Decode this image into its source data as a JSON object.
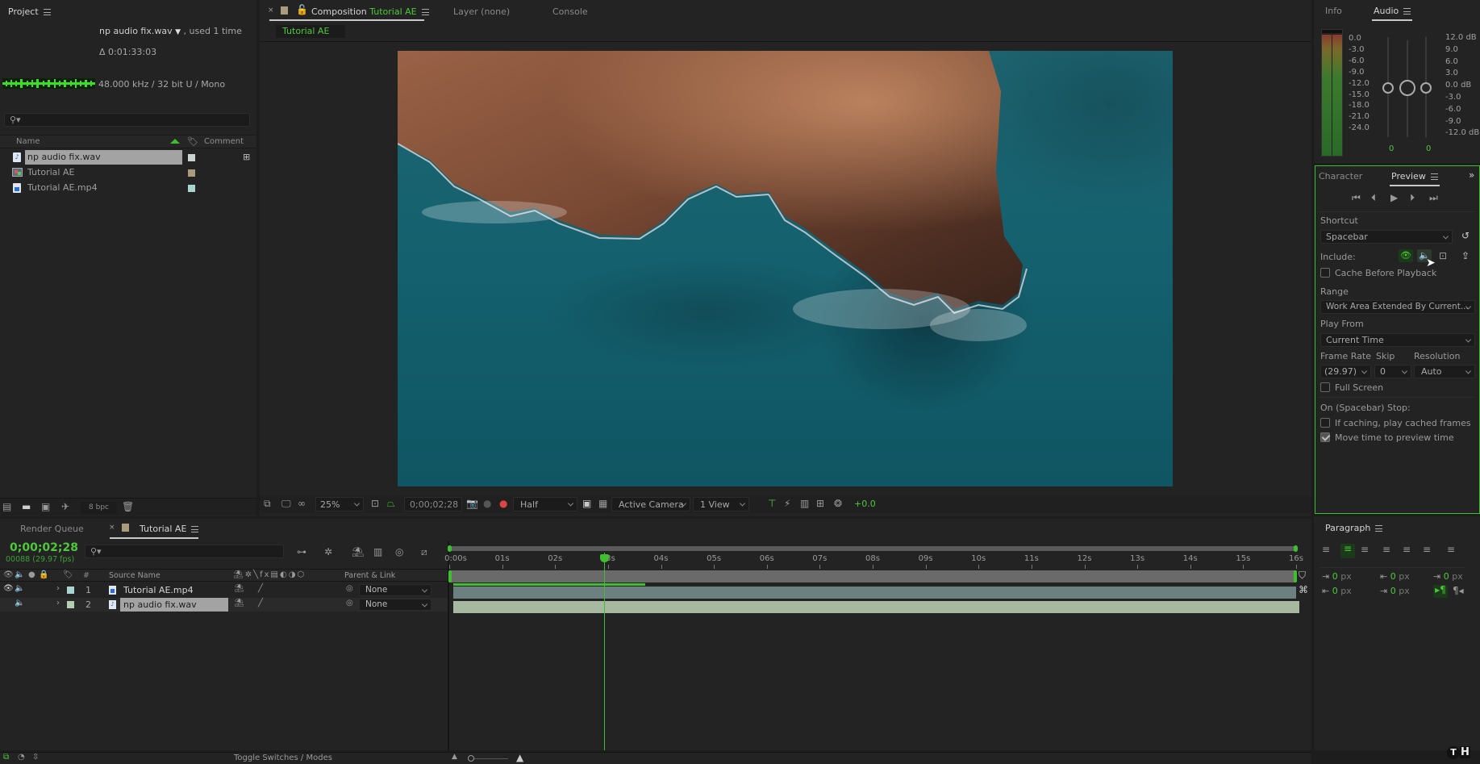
{
  "project_panel": {
    "title": "Project",
    "selected_item": {
      "name": "np audio fix.wav",
      "used": ", used 1 time",
      "duration": "Δ 0:01:33:03",
      "format": "48.000 kHz / 32 bit U / Mono"
    },
    "search_placeholder": "",
    "columns": {
      "name": "Name",
      "comment": "Comment"
    },
    "items": [
      {
        "name": "np audio fix.wav",
        "type": "audio",
        "label_color": "#c9d3d0",
        "selected": true
      },
      {
        "name": "Tutorial AE",
        "type": "composition",
        "label_color": "#a99b7c",
        "selected": false
      },
      {
        "name": "Tutorial AE.mp4",
        "type": "video",
        "label_color": "#a9d4d0",
        "selected": false
      }
    ],
    "bpc": "8 bpc"
  },
  "composition_panel": {
    "tabs": [
      {
        "label": "Composition",
        "comp_name": "Tutorial AE",
        "active": true
      },
      {
        "label": "Layer (none)",
        "active": false
      },
      {
        "label": "Console",
        "active": false
      }
    ],
    "breadcrumb": "Tutorial AE",
    "toolbar": {
      "zoom": "25%",
      "timecode": "0;00;02;28",
      "resolution": "Half",
      "camera": "Active Camera",
      "views": "1 View",
      "exposure": "+0.0"
    }
  },
  "audio_panel": {
    "tabs": [
      {
        "label": "Info",
        "active": false
      },
      {
        "label": "Audio",
        "active": true
      }
    ],
    "meter_scale": [
      "0.0",
      "-3.0",
      "-6.0",
      "-9.0",
      "-12.0",
      "-15.0",
      "-18.0",
      "-21.0",
      "-24.0"
    ],
    "db_scale": [
      "12.0 dB",
      "9.0",
      "6.0",
      "3.0",
      "0.0 dB",
      "-3.0",
      "-6.0",
      "-9.0",
      "-12.0 dB"
    ],
    "left_value": "0",
    "right_value": "0"
  },
  "preview_panel": {
    "tabs": [
      {
        "label": "Character",
        "active": false
      },
      {
        "label": "Preview",
        "active": true
      }
    ],
    "shortcut_label": "Shortcut",
    "shortcut_value": "Spacebar",
    "include_label": "Include:",
    "cache_before_playback": {
      "label": "Cache Before Playback",
      "checked": false
    },
    "range_label": "Range",
    "range_value": "Work Area Extended By Current...",
    "play_from_label": "Play From",
    "play_from_value": "Current Time",
    "frame_rate_label": "Frame Rate",
    "frame_rate_value": "(29.97)",
    "skip_label": "Skip",
    "skip_value": "0",
    "resolution_label": "Resolution",
    "resolution_value": "Auto",
    "full_screen": {
      "label": "Full Screen",
      "checked": false
    },
    "on_stop_label": "On (Spacebar) Stop:",
    "if_caching": {
      "label": "If caching, play cached frames",
      "checked": false
    },
    "move_time": {
      "label": "Move time to preview time",
      "checked": true
    }
  },
  "paragraph_panel": {
    "title": "Paragraph",
    "indent_left": "0",
    "indent_right": "0",
    "space_before": "0",
    "space_after": "0",
    "first_line": "0",
    "unit": "px"
  },
  "timeline": {
    "tabs": [
      {
        "label": "Render Queue",
        "active": false
      },
      {
        "label": "Tutorial AE",
        "active": true
      }
    ],
    "current_time": "0;00;02;28",
    "frame_info": "00088 (29.97 fps)",
    "columns": {
      "source_name": "Source Name",
      "parent": "Parent & Link"
    },
    "layers": [
      {
        "index": "1",
        "name": "Tutorial AE.mp4",
        "type": "video",
        "label_color": "#a9d4d0",
        "parent": "None",
        "video_on": true
      },
      {
        "index": "2",
        "name": "np audio fix.wav",
        "type": "audio",
        "label_color": "#b3cfb0",
        "parent": "None",
        "video_on": false
      }
    ],
    "ruler": [
      "0:00s",
      "01s",
      "02s",
      "03s",
      "04s",
      "05s",
      "06s",
      "07s",
      "08s",
      "09s",
      "10s",
      "11s",
      "12s",
      "13s",
      "14s",
      "15s",
      "16s"
    ],
    "playhead_seconds": 2.93,
    "duration_seconds": 16,
    "cached_until_seconds": 3.7,
    "toggle_label": "Toggle Switches / Modes"
  },
  "colors": {
    "accent_green": "#4ec83a",
    "panel_bg": "#232323",
    "dark_bg": "#1b1b1b"
  }
}
